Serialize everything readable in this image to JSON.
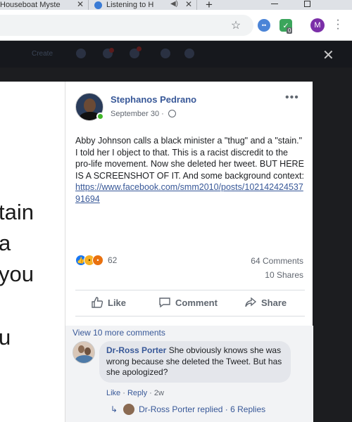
{
  "browser": {
    "tabs": [
      {
        "title": "Houseboat Myste"
      },
      {
        "title": "Listening to H"
      }
    ],
    "new_tab_symbol": "+",
    "close_symbol": "✕",
    "profile_initial": "M",
    "extension_badge": "0"
  },
  "facebook_bar": {
    "create_label": "Create"
  },
  "viewer": {
    "close_symbol": "✕",
    "photo_text_lines": [
      "tain",
      "a",
      "you",
      "",
      "u"
    ]
  },
  "post": {
    "author": "Stephanos Pedrano",
    "date": "September 30 ·",
    "options_symbol": "•••",
    "text": "Abby Johnson calls a black minister a \"thug\" and a \"stain.\" I told her I object to that. This is a racist discredit to the pro-life movement. Now she deleted her tweet. BUT HERE IS A SCREENSHOT OF IT. And some background context:",
    "link": "https://www.facebook.com/smm2010/posts/10214242453791694",
    "reaction_count": "62",
    "comment_count": "64 Comments",
    "share_count": "10 Shares",
    "actions": {
      "like": "Like",
      "comment": "Comment",
      "share": "Share"
    }
  },
  "comments": {
    "view_more": "View 10 more comments",
    "items": [
      {
        "author": "Dr-Ross Porter",
        "text": " She obviously knows she was wrong because she deleted the Tweet. But has she apologized?",
        "like": "Like",
        "separator1": " · ",
        "reply": "Reply",
        "separator2": " · ",
        "age": "2w"
      }
    ],
    "reply_summary": "Dr-Ross Porter replied · 6 Replies"
  },
  "icons": {
    "star": "star-icon",
    "globe": "globe-icon",
    "like": "thumbs-up-icon",
    "comment": "speech-bubble-icon",
    "share": "share-arrow-icon"
  },
  "colors": {
    "facebook_blue": "#385898",
    "like_reaction": "#1877f2",
    "online": "#42b72a"
  }
}
